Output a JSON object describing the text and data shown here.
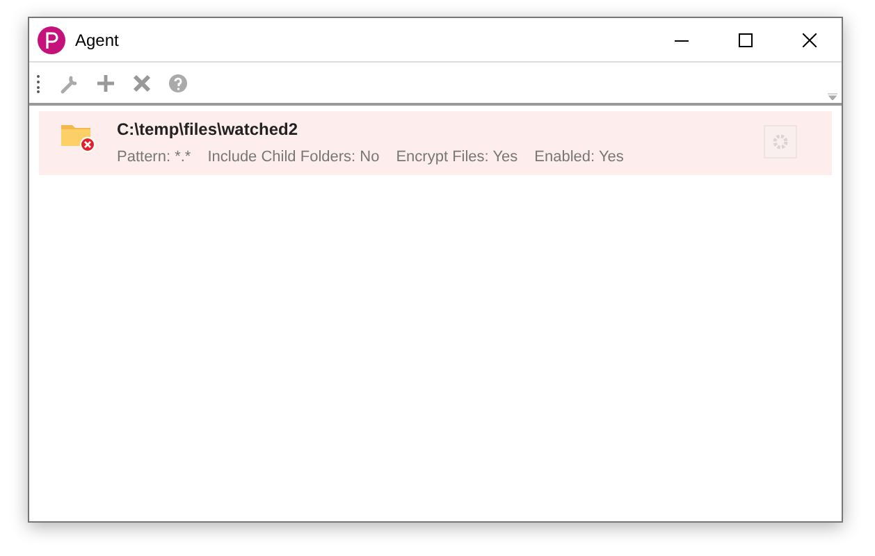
{
  "window": {
    "title": "Agent"
  },
  "toolbar": [
    {
      "kind": "wrench"
    },
    {
      "kind": "add"
    },
    {
      "kind": "delete"
    },
    {
      "kind": "help"
    }
  ],
  "folders": [
    {
      "path": "C:\\temp\\files\\watched2",
      "error": true,
      "details": [
        "Pattern: *.*",
        "Include Child Folders: No",
        "Encrypt Files: Yes",
        "Enabled: Yes"
      ],
      "action_disabled": true
    }
  ]
}
